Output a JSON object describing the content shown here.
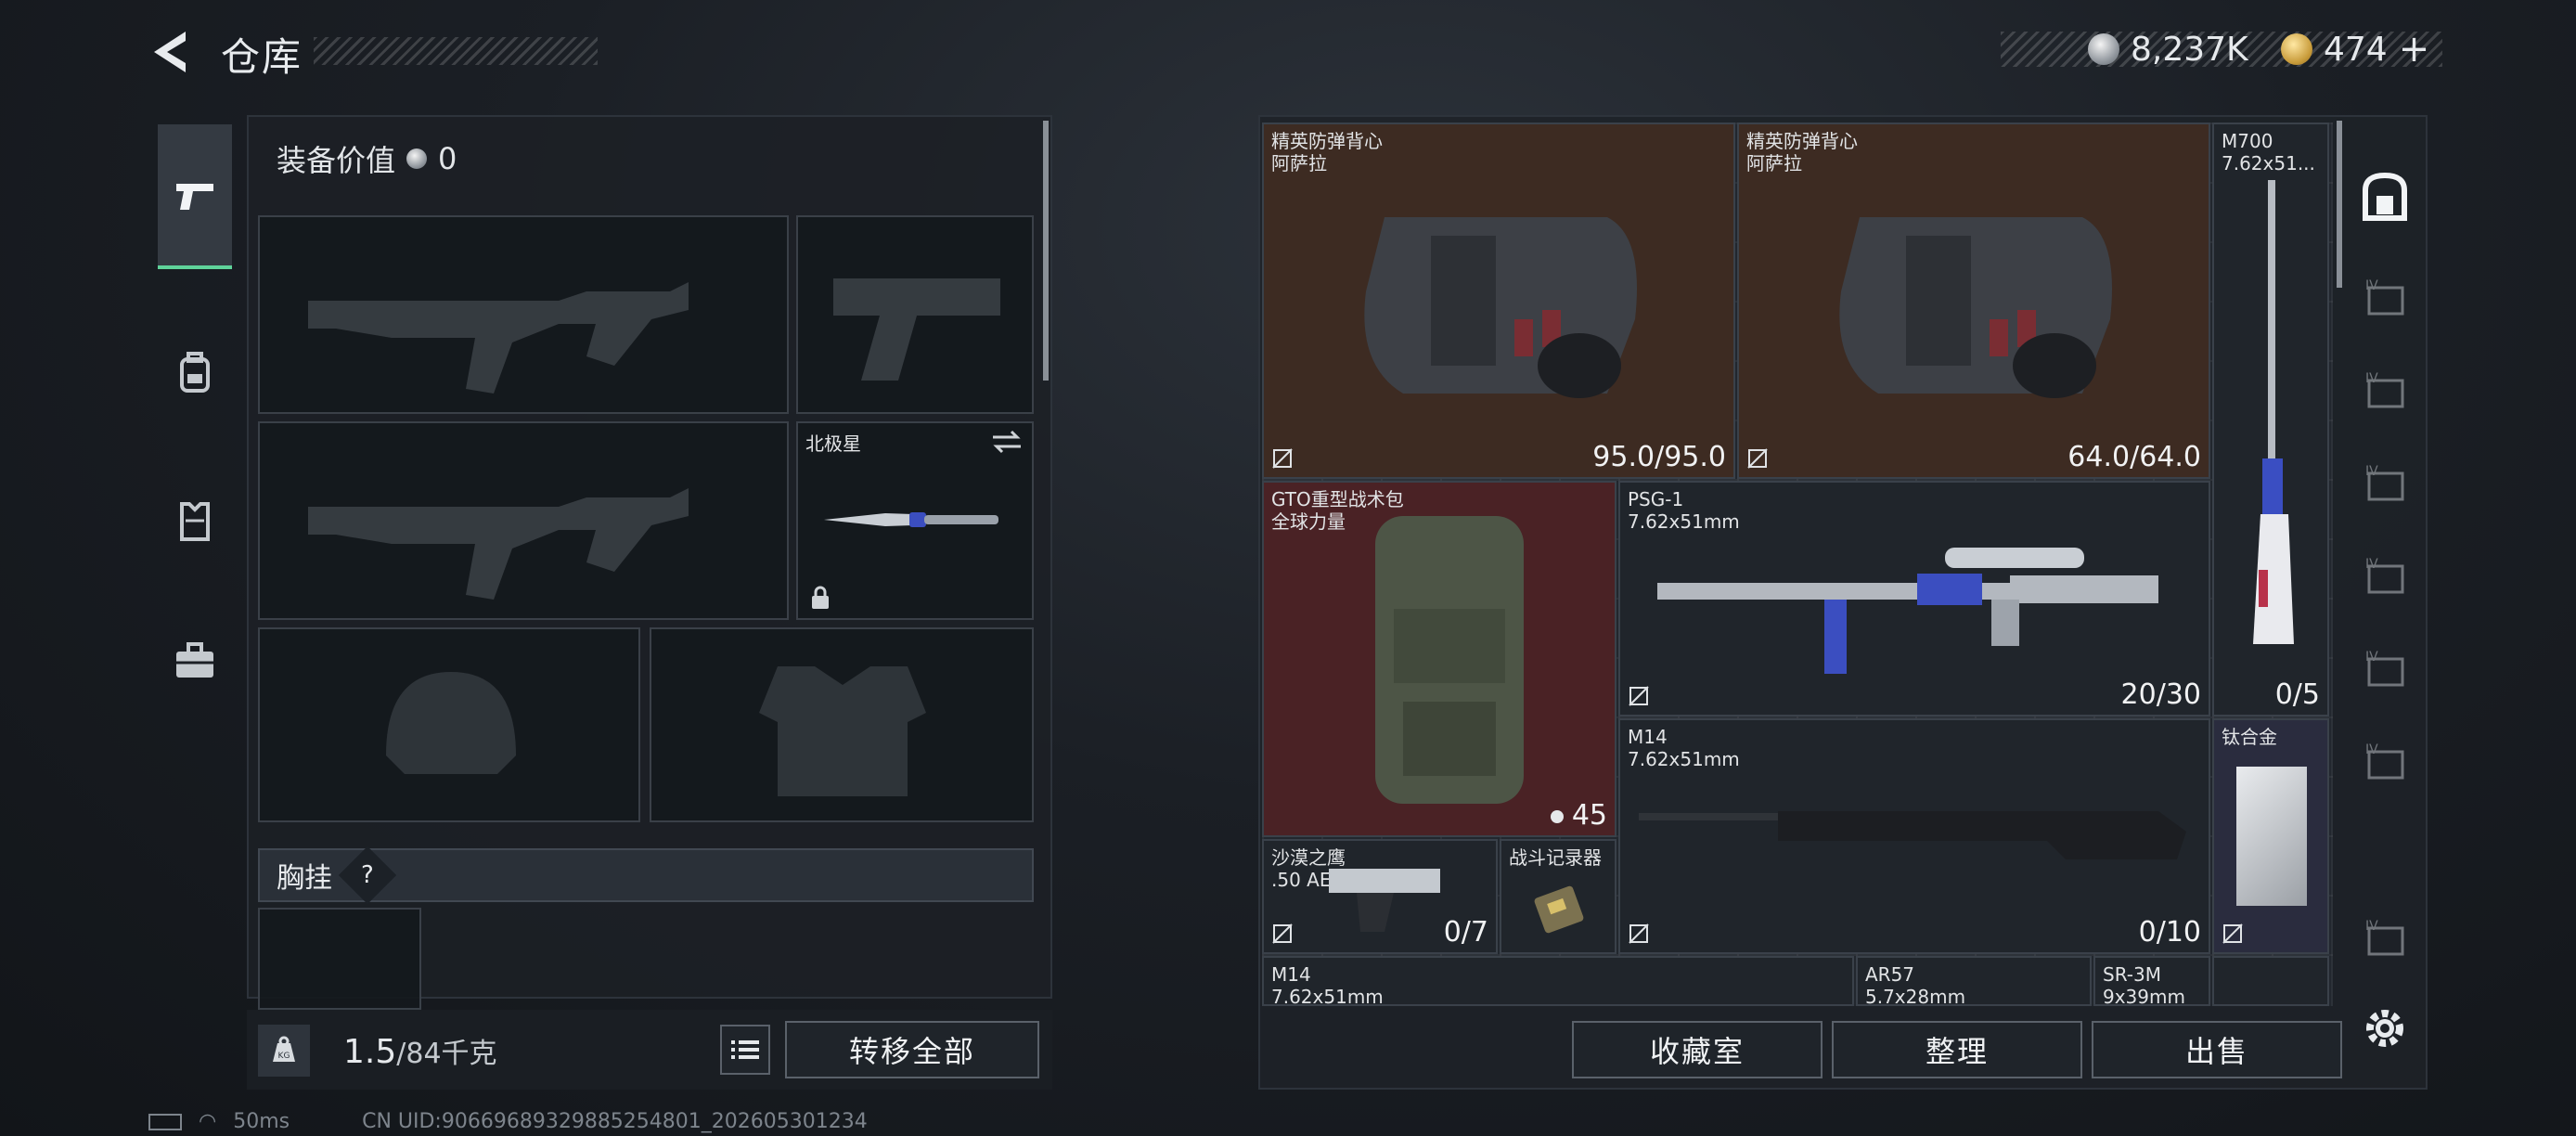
{
  "header": {
    "title": "仓库"
  },
  "currency": {
    "silver": "8,237K",
    "gold": "474",
    "gold_plus": "+"
  },
  "left_panel": {
    "equip_value_label": "装备价值",
    "equip_value": "0",
    "knife": {
      "name": "北极星"
    },
    "chest_rig": {
      "label": "胸挂",
      "help": "?"
    },
    "weight": {
      "current": "1.5",
      "capacity": "/84千克",
      "icon_label": "KG"
    },
    "transfer_all": "转移全部"
  },
  "stash": {
    "items": [
      {
        "id": "vest1",
        "name": "精英防弹背心",
        "sub": "阿萨拉",
        "value": "95.0/95.0"
      },
      {
        "id": "vest2",
        "name": "精英防弹背心",
        "sub": "阿萨拉",
        "value": "64.0/64.0"
      },
      {
        "id": "m700",
        "name": "M700",
        "sub": "7.62x51...",
        "value": "0/5"
      },
      {
        "id": "bag",
        "name": "GTO重型战术包",
        "sub": "全球力量",
        "value": "45"
      },
      {
        "id": "psg1",
        "name": "PSG-1",
        "sub": "7.62x51mm",
        "value": "20/30"
      },
      {
        "id": "m14",
        "name": "M14",
        "sub": "7.62x51mm",
        "value": "0/10"
      },
      {
        "id": "titanium",
        "name": "钛合金",
        "sub": "",
        "value": ""
      },
      {
        "id": "eagle",
        "name": "沙漠之鹰",
        "sub": ".50 AE",
        "value": "0/7"
      },
      {
        "id": "recorder",
        "name": "战斗记录器",
        "sub": "",
        "value": ""
      },
      {
        "id": "m14b",
        "name": "M14",
        "sub": "7.62x51mm",
        "value": ""
      },
      {
        "id": "ar57",
        "name": "AR57",
        "sub": "5.7x28mm",
        "value": ""
      },
      {
        "id": "sr3m",
        "name": "SR-3M",
        "sub": "9x39mm",
        "value": ""
      }
    ],
    "buttons": {
      "collection": "收藏室",
      "sort": "整理",
      "sell": "出售"
    }
  },
  "status_bar": {
    "ping": "50ms",
    "uid": "CN UID:9066968932988525480​1_202605301234"
  },
  "colors": {
    "accent_green": "#5fd39a",
    "vest_bg": "#3d2b22",
    "bag_bg": "#4a2225"
  },
  "icons": [
    "back-arrow-icon",
    "silver-coin-icon",
    "gold-coin-icon",
    "pistol-icon",
    "backpack-icon",
    "vest-icon",
    "briefcase-icon",
    "swap-icon",
    "lock-icon",
    "weight-icon",
    "list-icon",
    "safe-icon",
    "settings-icon"
  ]
}
